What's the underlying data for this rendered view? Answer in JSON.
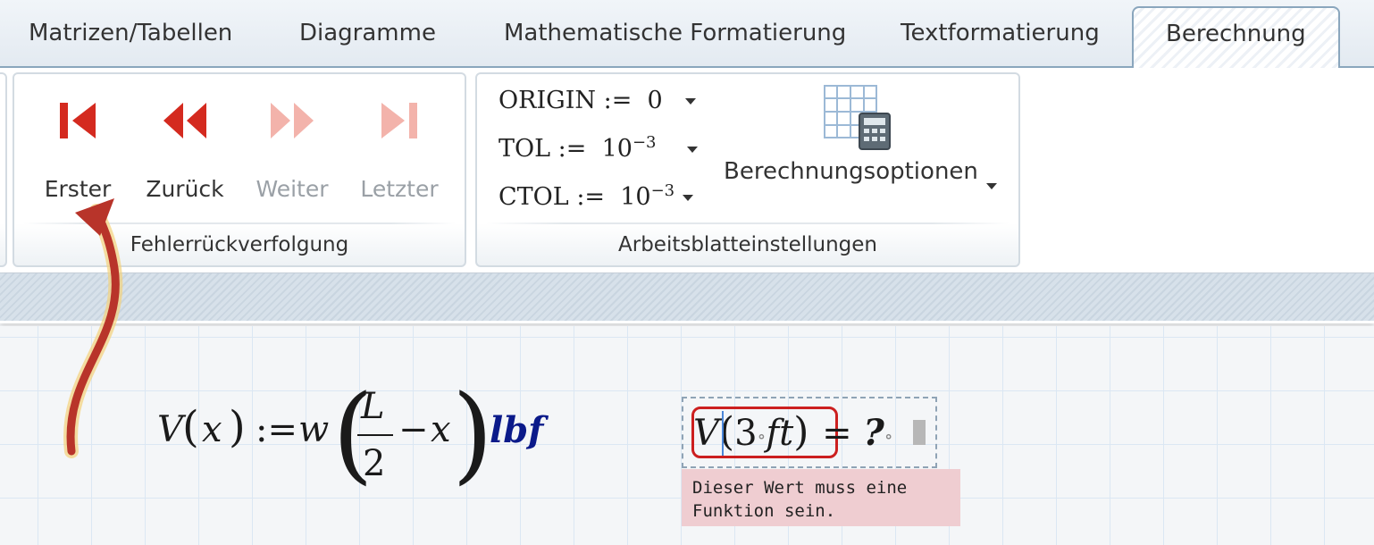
{
  "tabs": [
    {
      "label": "Matrizen/Tabellen"
    },
    {
      "label": "Diagramme"
    },
    {
      "label": "Mathematische Formatierung"
    },
    {
      "label": "Textformatierung"
    },
    {
      "label": "Berechnung",
      "active": true
    }
  ],
  "ribbon": {
    "error_tracing": {
      "caption": "Fehlerrückverfolgung",
      "buttons": [
        {
          "label": "Erster",
          "icon": "first-icon",
          "enabled": true
        },
        {
          "label": "Zurück",
          "icon": "back-icon",
          "enabled": true
        },
        {
          "label": "Weiter",
          "icon": "forward-icon",
          "enabled": false
        },
        {
          "label": "Letzter",
          "icon": "last-icon",
          "enabled": false
        }
      ]
    },
    "worksheet_settings": {
      "caption": "Arbeitsblatteinstellungen",
      "origin": {
        "name": "ORIGIN",
        "assign": ":=",
        "value": "0"
      },
      "tol": {
        "name": "TOL",
        "assign": ":=",
        "base": "10",
        "exp": "−3"
      },
      "ctol": {
        "name": "CTOL",
        "assign": ":=",
        "base": "10",
        "exp": "−3"
      },
      "options_label": "Berechnungsoptionen",
      "options_icon": "calculation-options-icon"
    }
  },
  "worksheet": {
    "definition": {
      "func": "V",
      "arg": "x",
      "assign": ":=",
      "factor": "w",
      "numerator": "L",
      "denominator": "2",
      "minus": "−",
      "var": "x",
      "unit": "lbf"
    },
    "evaluation": {
      "func": "V",
      "arg_num": "3",
      "arg_unit": "ft",
      "equals": "=",
      "result": "?"
    },
    "error_message": "Dieser Wert muss eine Funktion sein."
  },
  "colors": {
    "nav_active": "#d42a1f",
    "nav_disabled": "#f3b3ab",
    "error_border": "#cc1f1f",
    "unit": "#0b1a8a",
    "error_bg": "#efcdd1",
    "annotation_arrow": "#b8342a"
  }
}
